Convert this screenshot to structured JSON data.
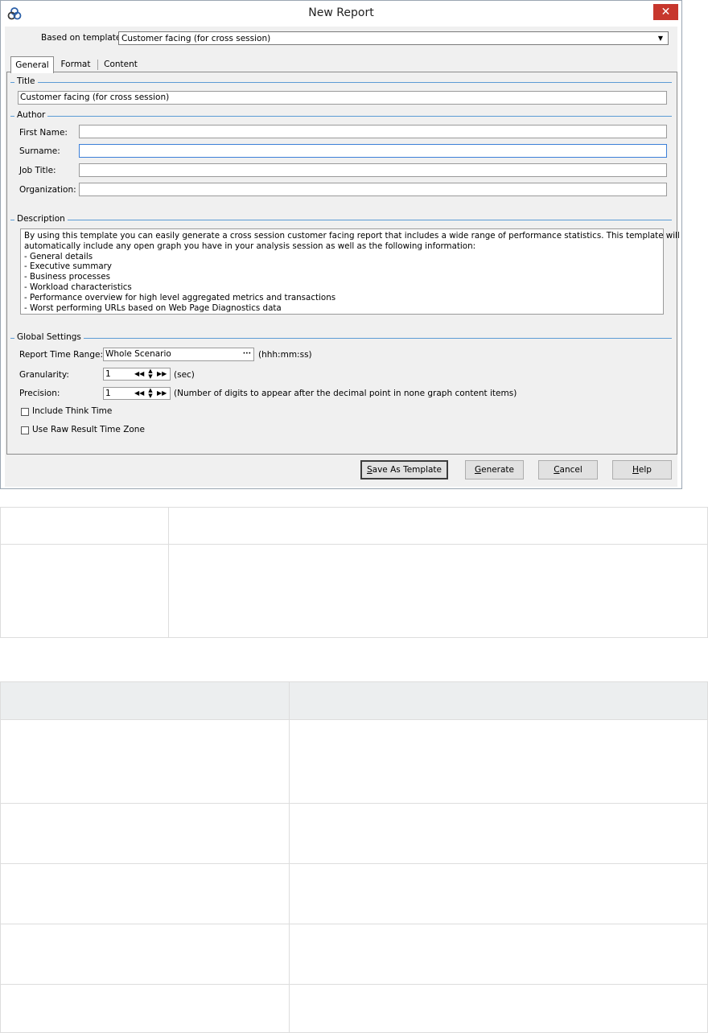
{
  "window": {
    "title": "New Report",
    "close_glyph": "✕"
  },
  "template": {
    "label": "Based on template",
    "value": "Customer facing (for cross session)"
  },
  "tabs": [
    {
      "label": "General",
      "active": true
    },
    {
      "label": "Format",
      "active": false
    },
    {
      "label": "Content",
      "active": false
    }
  ],
  "title_group": {
    "label": "Title",
    "value": "Customer facing (for cross session)"
  },
  "author_group": {
    "label": "Author",
    "fields": [
      {
        "label": "First Name:",
        "value": ""
      },
      {
        "label": "Surname:",
        "value": ""
      },
      {
        "label": "Job Title:",
        "value": ""
      },
      {
        "label": "Organization:",
        "value": ""
      }
    ]
  },
  "description_group": {
    "label": "Description",
    "lines": [
      "By using this template you can easily generate a cross session customer facing report that includes a wide range of performance statistics. This template will",
      "automatically include any open graph you have in your analysis session as well as the following information:",
      "- General details",
      "- Executive summary",
      "- Business processes",
      "- Workload characteristics",
      "- Performance overview for high level aggregated metrics and transactions",
      "- Worst performing URLs based on Web Page Diagnostics data"
    ]
  },
  "global_settings": {
    "label": "Global Settings",
    "time_range_label": "Report Time Range:",
    "time_range_value": "Whole Scenario",
    "time_range_button": "···",
    "time_range_unit": "(hhh:mm:ss)",
    "granularity_label": "Granularity:",
    "granularity_value": "1",
    "granularity_unit": "(sec)",
    "precision_label": "Precision:",
    "precision_value": "1",
    "precision_note": "(Number of digits to appear after the decimal point in none graph content items)",
    "include_think_time_label": "Include Think Time",
    "raw_result_tz_label": "Use Raw Result Time Zone"
  },
  "buttons": {
    "save_as_template_mnemonic": "S",
    "save_as_template_rest": "ave As Template",
    "generate_mnemonic": "G",
    "generate_rest": "enerate",
    "cancel_mnemonic": "C",
    "cancel_rest": "ancel",
    "help_mnemonic": "H",
    "help_rest": "elp"
  }
}
